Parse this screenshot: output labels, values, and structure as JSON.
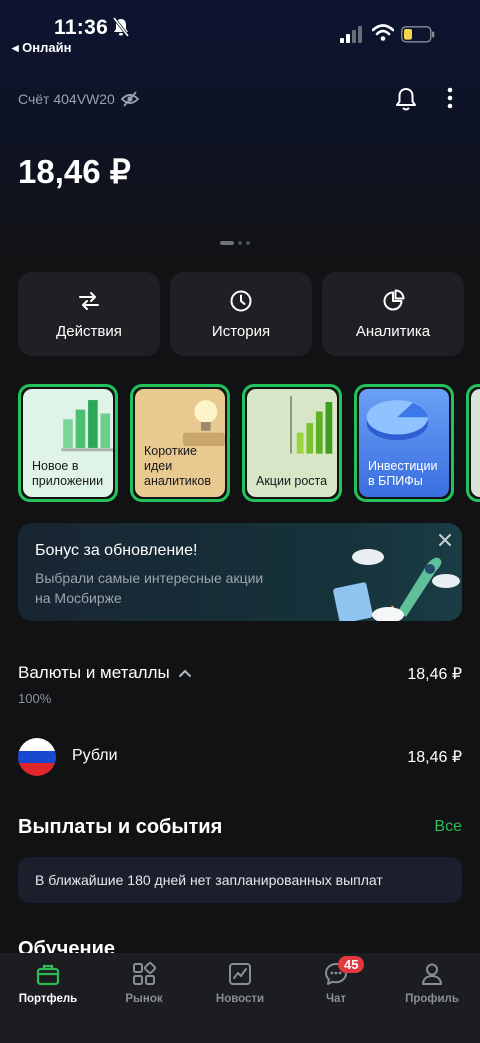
{
  "status_bar": {
    "time": "11:36",
    "back_label": "◂ Онлайн"
  },
  "account": {
    "label": "Счёт 404VW20",
    "balance": "18,46 ₽"
  },
  "actions": [
    {
      "label": "Действия",
      "icon": "transfer-arrows-icon"
    },
    {
      "label": "История",
      "icon": "clock-icon"
    },
    {
      "label": "Аналитика",
      "icon": "pie-chart-icon"
    }
  ],
  "stories": [
    {
      "label": "Новое в приложении",
      "bg": "#dff3e7"
    },
    {
      "label": "Короткие идеи аналитиков",
      "bg": "#e8c98f"
    },
    {
      "label": "Акции роста",
      "bg": "#d8e6c8"
    },
    {
      "label": "Инвестиции в БПИФы",
      "bg": "#3a6ee0"
    }
  ],
  "promo": {
    "title": "Бонус за обновление!",
    "subtitle": "Выбрали самые интересные акции на Мосбирже"
  },
  "portfolio_section": {
    "title": "Валюты и металлы",
    "value": "18,46 ₽",
    "percent": "100%",
    "asset": {
      "name": "Рубли",
      "value": "18,46 ₽"
    }
  },
  "events": {
    "title": "Выплаты и события",
    "all_link": "Все",
    "empty_text": "В ближайшие 180 дней нет запланированных выплат"
  },
  "education": {
    "title": "Обучение"
  },
  "tabbar": {
    "items": [
      {
        "label": "Портфель",
        "icon": "briefcase-icon"
      },
      {
        "label": "Рынок",
        "icon": "grid-icon"
      },
      {
        "label": "Новости",
        "icon": "chart-news-icon"
      },
      {
        "label": "Чат",
        "icon": "chat-icon",
        "badge": "45"
      },
      {
        "label": "Профиль",
        "icon": "person-icon"
      }
    ]
  },
  "colors": {
    "accent_green": "#21c35a",
    "badge_red": "#e2383f",
    "background": "#111214"
  }
}
